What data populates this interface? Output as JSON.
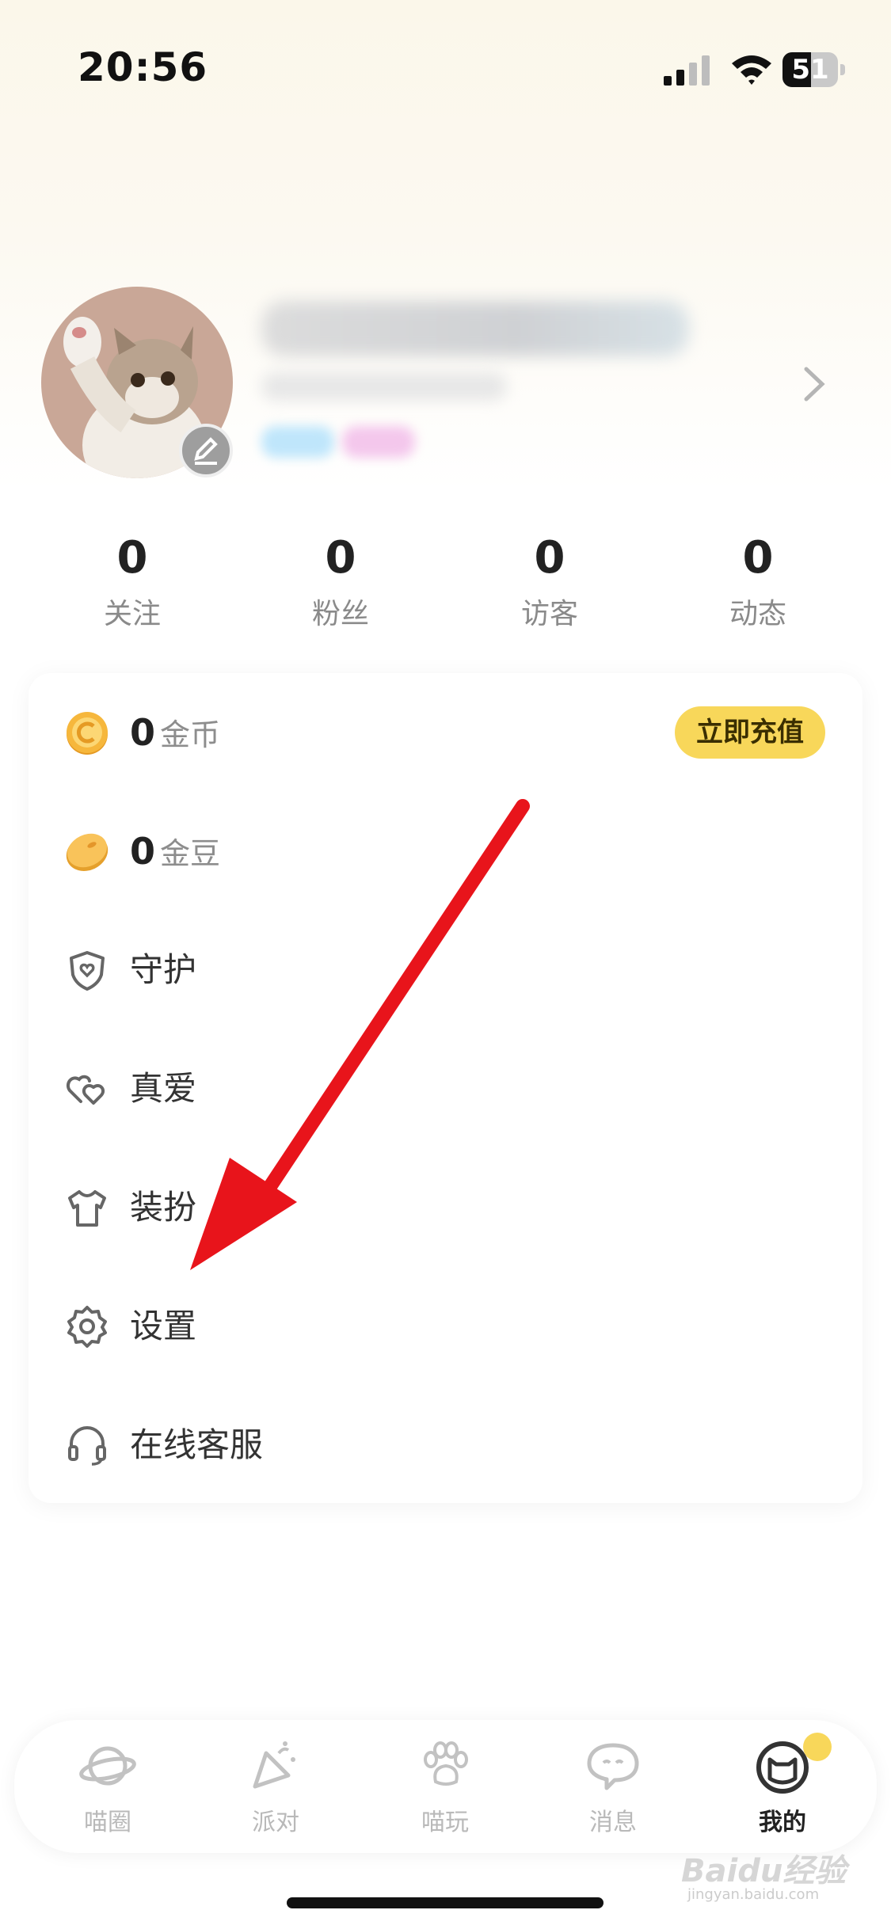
{
  "status_bar": {
    "time": "20:56",
    "battery": "51",
    "battery_level": 0.51
  },
  "profile": {
    "chevron_icon": "chevron-right-icon",
    "edit_icon": "pencil-icon"
  },
  "stats": [
    {
      "value": "0",
      "label": "关注"
    },
    {
      "value": "0",
      "label": "粉丝"
    },
    {
      "value": "0",
      "label": "访客"
    },
    {
      "value": "0",
      "label": "动态"
    }
  ],
  "wallet": {
    "coins": {
      "value": "0",
      "unit": "金币",
      "icon": "gold-coin-icon",
      "action": "立即充值"
    },
    "beans": {
      "value": "0",
      "unit": "金豆",
      "icon": "gold-bean-icon"
    }
  },
  "menu": [
    {
      "label": "守护",
      "icon": "shield-icon"
    },
    {
      "label": "真爱",
      "icon": "hearts-icon"
    },
    {
      "label": "装扮",
      "icon": "tshirt-icon"
    },
    {
      "label": "设置",
      "icon": "gear-icon"
    },
    {
      "label": "在线客服",
      "icon": "headset-icon"
    }
  ],
  "tabbar": [
    {
      "label": "喵圈",
      "icon": "planet-icon"
    },
    {
      "label": "派对",
      "icon": "party-popper-icon"
    },
    {
      "label": "喵玩",
      "icon": "paw-icon"
    },
    {
      "label": "消息",
      "icon": "chat-bubble-icon"
    },
    {
      "label": "我的",
      "icon": "cat-face-icon",
      "active": true
    }
  ],
  "watermark": {
    "main": "Baidu经验",
    "sub": "jingyan.baidu.com"
  },
  "colors": {
    "accent": "#f8d75a",
    "arrow": "#e8141b"
  }
}
